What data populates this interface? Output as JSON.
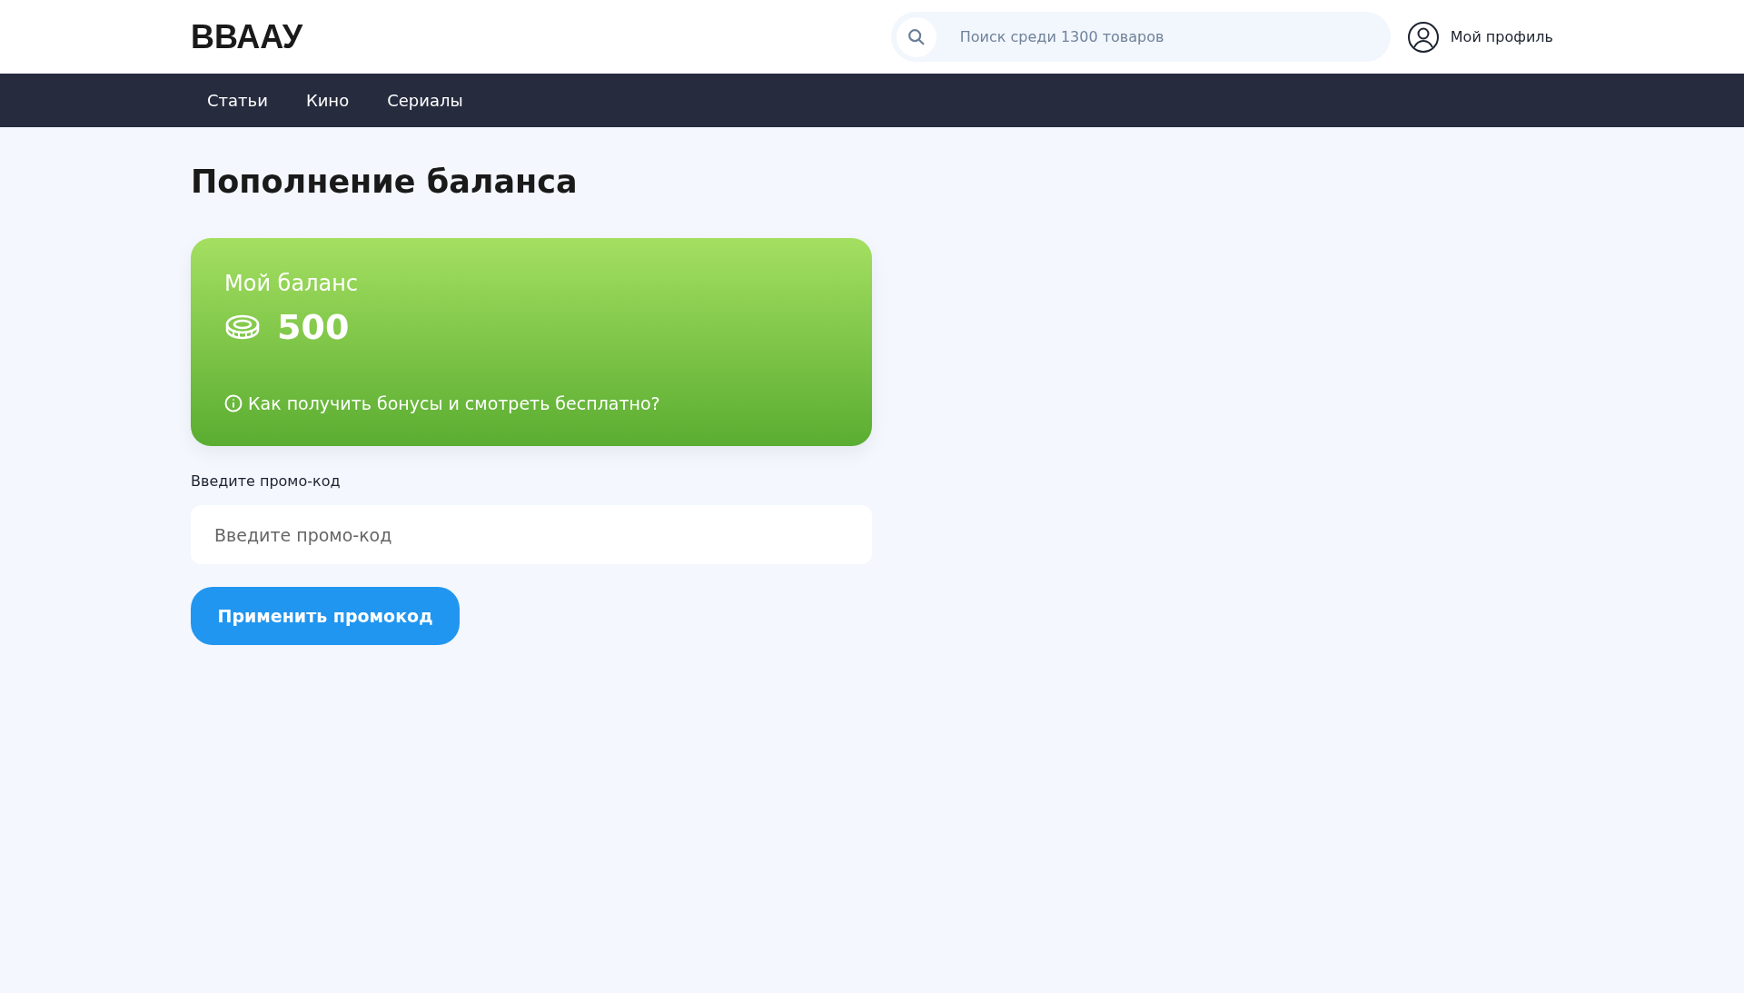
{
  "header": {
    "logo": "ВВААУ",
    "search": {
      "placeholder": "Поиск среди 1300 товаров"
    },
    "profile": "Мой профиль"
  },
  "nav": [
    "Статьи",
    "Кино",
    "Сериалы"
  ],
  "page_title": "Пополнение баланса",
  "balance_card": {
    "title": "Мой баланс",
    "amount": "500",
    "help_link": "Как получить бонусы и смотреть бесплатно?"
  },
  "promo": {
    "label": "Введите промо-код",
    "placeholder": "Введите промо-код",
    "button": "Применить промокод"
  }
}
